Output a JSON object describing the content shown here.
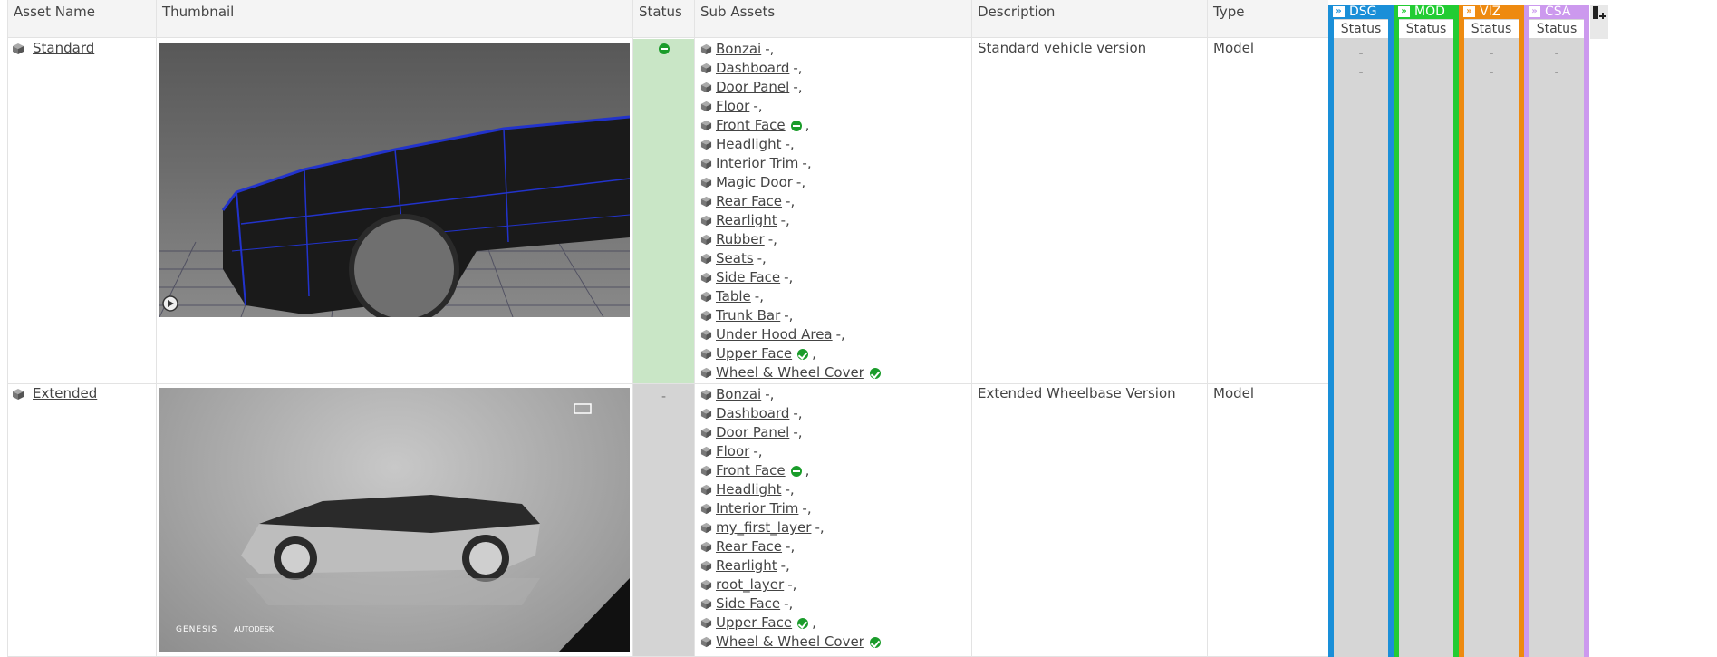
{
  "columns": {
    "asset_name": "Asset Name",
    "thumbnail": "Thumbnail",
    "status": "Status",
    "sub_assets": "Sub Assets",
    "description": "Description",
    "type": "Type"
  },
  "task_columns": [
    {
      "code": "DSG",
      "sub": "Status",
      "color": "#1a8fd8"
    },
    {
      "code": "MOD",
      "sub": "Status",
      "color": "#22cc33"
    },
    {
      "code": "VIZ",
      "sub": "Status",
      "color": "#ee8a10"
    },
    {
      "code": "CSA",
      "sub": "Status",
      "color": "#cc99ee"
    }
  ],
  "task_values": {
    "row1_a": [
      "-",
      "",
      "-",
      "-"
    ],
    "row1_b": [
      "-",
      "",
      "-",
      "-"
    ]
  },
  "rows": [
    {
      "name": "Standard",
      "status": "",
      "description": "Standard vehicle version",
      "type": "Model",
      "sub_assets": [
        {
          "name": "Bonzai",
          "suffix": "-,"
        },
        {
          "name": "Dashboard",
          "suffix": "-,"
        },
        {
          "name": "Door Panel",
          "suffix": "-,"
        },
        {
          "name": "Floor",
          "suffix": "-,"
        },
        {
          "name": "Front Face",
          "suffix": ","
        },
        {
          "name": "Headlight",
          "suffix": "-,"
        },
        {
          "name": "Interior Trim",
          "suffix": "-,"
        },
        {
          "name": "Magic Door",
          "suffix": "-,"
        },
        {
          "name": "Rear Face",
          "suffix": "-,"
        },
        {
          "name": "Rearlight",
          "suffix": "-,"
        },
        {
          "name": "Rubber",
          "suffix": "-,"
        },
        {
          "name": "Seats",
          "suffix": "-,"
        },
        {
          "name": "Side Face",
          "suffix": "-,"
        },
        {
          "name": "Table",
          "suffix": "-,"
        },
        {
          "name": "Trunk Bar",
          "suffix": "-,"
        },
        {
          "name": "Under Hood Area",
          "suffix": "-,"
        },
        {
          "name": "Upper Face",
          "suffix": ","
        },
        {
          "name": "Wheel & Wheel Cover",
          "suffix": ""
        }
      ]
    },
    {
      "name": "Extended",
      "status": "-",
      "description": "Extended Wheelbase Version",
      "type": "Model",
      "sub_assets": [
        {
          "name": "Bonzai",
          "suffix": "-,"
        },
        {
          "name": "Dashboard",
          "suffix": "-,"
        },
        {
          "name": "Door Panel",
          "suffix": "-,"
        },
        {
          "name": "Floor",
          "suffix": "-,"
        },
        {
          "name": "Front Face",
          "suffix": ","
        },
        {
          "name": "Headlight",
          "suffix": "-,"
        },
        {
          "name": "Interior Trim",
          "suffix": "-,"
        },
        {
          "name": "my_first_layer",
          "suffix": "-,"
        },
        {
          "name": "Rear Face",
          "suffix": "-,"
        },
        {
          "name": "Rearlight",
          "suffix": "-,"
        },
        {
          "name": "root_layer",
          "suffix": "-,"
        },
        {
          "name": "Side Face",
          "suffix": "-,"
        },
        {
          "name": "Upper Face",
          "suffix": ","
        },
        {
          "name": "Wheel & Wheel Cover",
          "suffix": ""
        }
      ]
    }
  ],
  "thumb2_brand": "GENESIS",
  "thumb2_partner": "AUTODESK",
  "colors": {
    "status_green_bg": "#c9e6c6",
    "status_grey_bg": "#d4d4d4",
    "row_bg_grey": "#d6d6d6",
    "dot_green": "#1a9c2a"
  }
}
